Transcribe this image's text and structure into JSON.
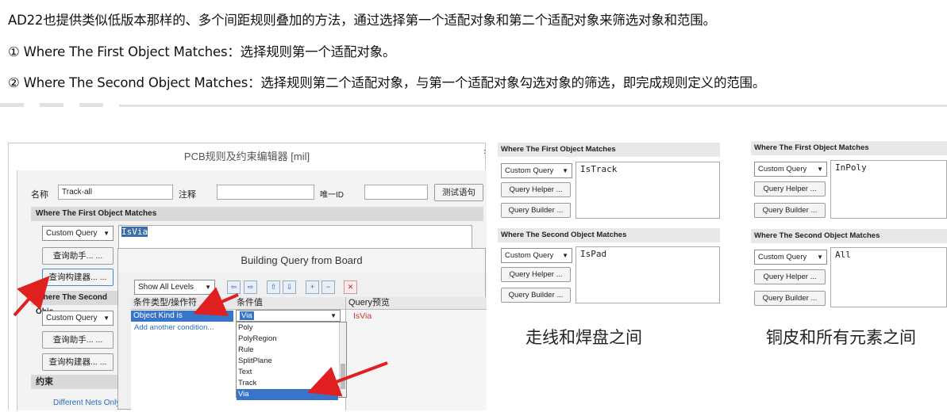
{
  "intro": {
    "line1": "AD22也提供类似低版本那样的、多个间距规则叠加的方法，通过选择第一个适配对象和第二个适配对象来筛选对象和范围。",
    "line2": "① Where The First Object Matches：选择规则第一个适配对象。",
    "line3": "② Where The Second Object Matches：选择规则第二个适配对象，与第一个适配对象勾选对象的筛选，即完成规则定义的范围。"
  },
  "editor": {
    "title": "PCB规则及约束编辑器 [mil]",
    "name_label": "名称",
    "name_value": "Track-all",
    "comment_label": "注释",
    "id_label": "唯一ID",
    "test_button": "测试语句",
    "first_section": "Where The First Object Matches",
    "first_combo": "Custom Query",
    "first_query": "IsVia",
    "helper_button": "查询助手... ...",
    "builder_button": "查询构建器... ...",
    "second_section": "Where The Second Obje",
    "second_combo": "Custom Query",
    "second_helper_button": "查询助手... ...",
    "second_builder_button": "查询构建器... ...",
    "constraint_label": "约束",
    "constraint_text": "Different Nets Only"
  },
  "builder": {
    "title": "Building Query from Board",
    "levels_combo": "Show All Levels",
    "col_condition": "条件类型/操作符",
    "col_value": "条件值",
    "col_preview": "Query预览",
    "condition": "Object Kind is",
    "add_condition": "Add another condition...",
    "value": "Via",
    "preview": "IsVia",
    "options": [
      "Poly",
      "PolyRegion",
      "Rule",
      "SplitPlane",
      "Text",
      "Track",
      "Via"
    ],
    "tool_icons": [
      "prev-icon",
      "next-icon",
      "up-icon",
      "down-icon",
      "add-rule-icon",
      "remove-rule-icon",
      "delete-icon"
    ]
  },
  "panels": [
    {
      "first_head": "Where The First Object Matches",
      "first_combo": "Custom Query",
      "first_query": "IsTrack",
      "first_helper": "Query Helper ...",
      "first_builder": "Query Builder ...",
      "second_head": "Where The Second Object Matches",
      "second_combo": "Custom Query",
      "second_query": "IsPad",
      "second_helper": "Query Helper ...",
      "second_builder": "Query Builder ...",
      "caption": "走线和焊盘之间"
    },
    {
      "first_head": "Where The First Object Matches",
      "first_combo": "Custom Query",
      "first_query": "InPoly",
      "first_helper": "Query Helper ...",
      "first_builder": "Query Builder ...",
      "second_head": "Where The Second Object Matches",
      "second_combo": "Custom Query",
      "second_query": "All",
      "second_helper": "Query Helper ...",
      "second_builder": "Query Builder ...",
      "caption": "铜皮和所有元素之间"
    }
  ],
  "colors": {
    "selection": "#3874c8",
    "arrow": "#e02020",
    "preview_text": "#c0392b"
  }
}
